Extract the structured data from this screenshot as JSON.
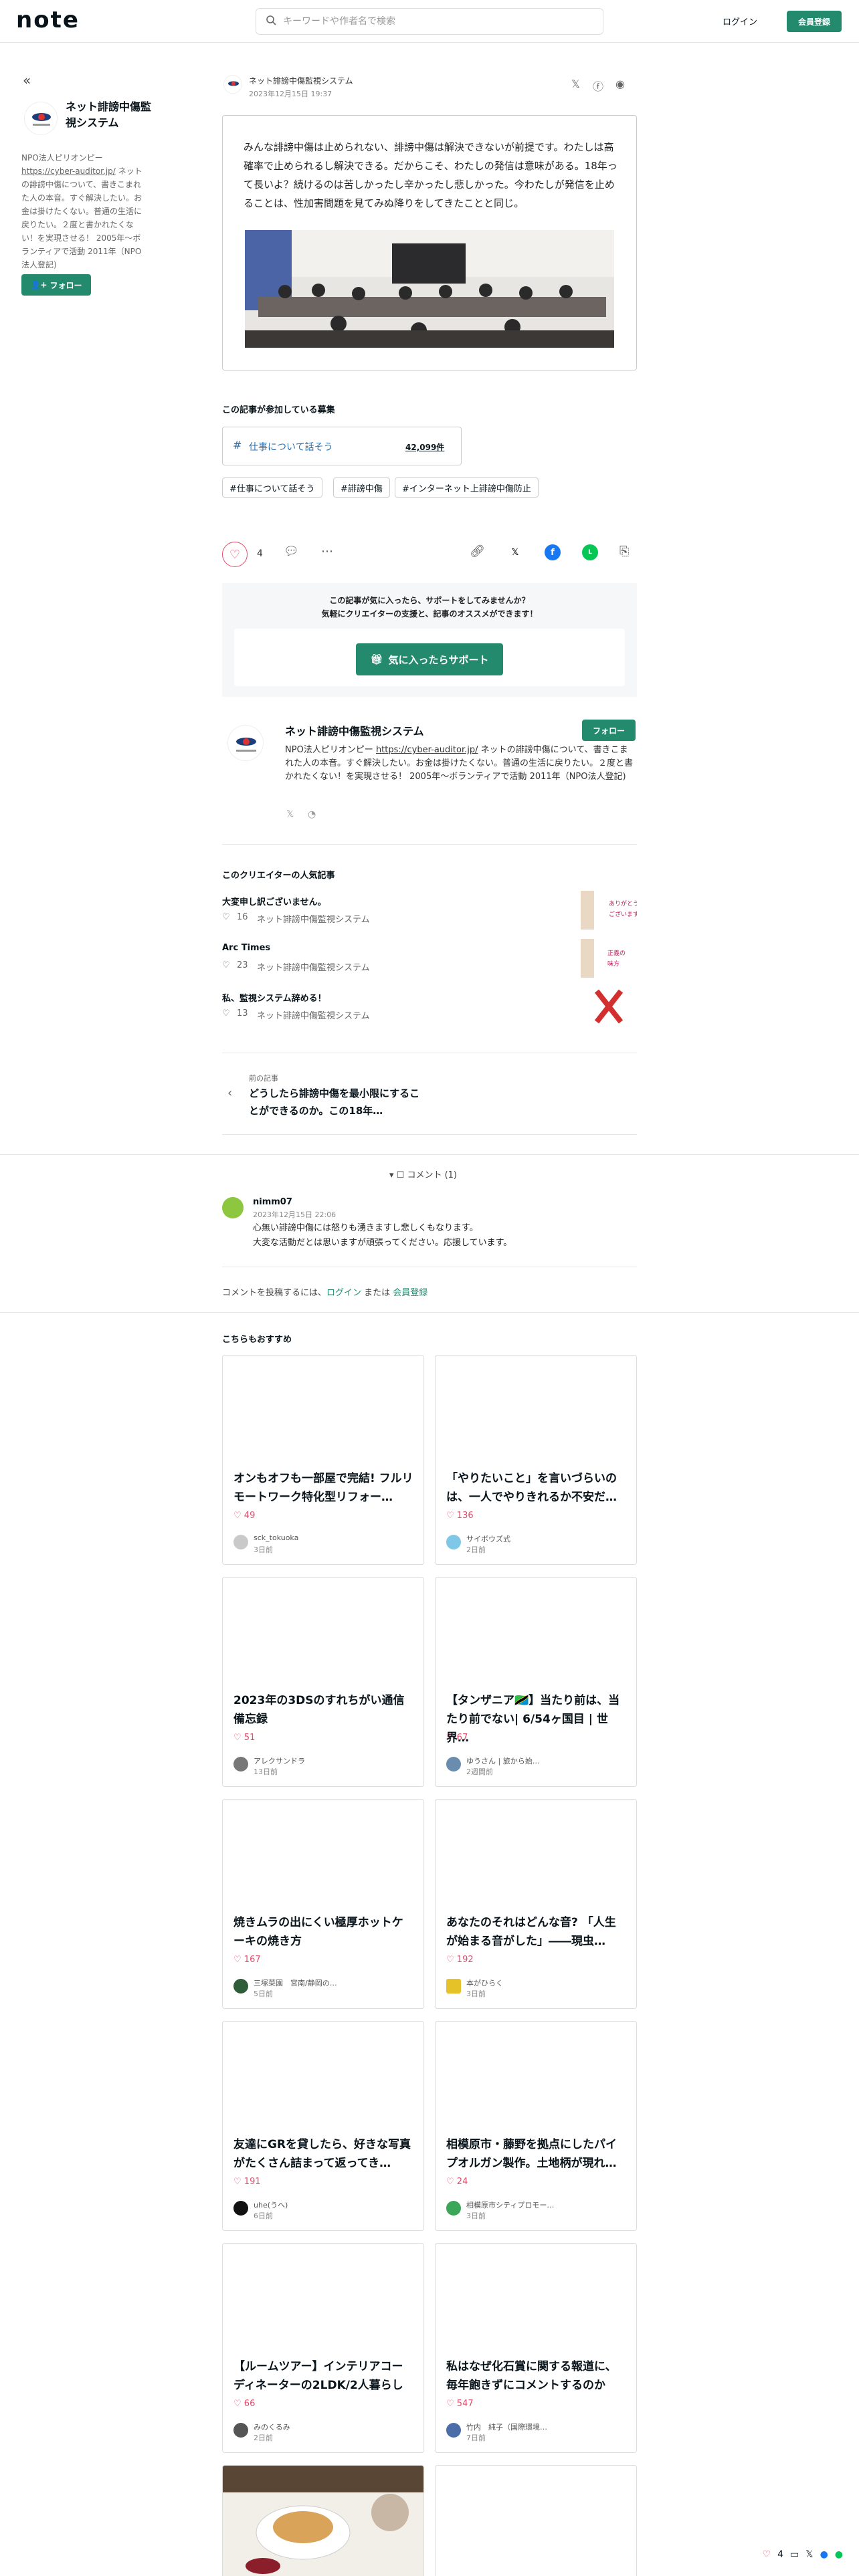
{
  "header": {
    "logo": "note",
    "search_placeholder": "キーワードや作者名で検索",
    "login": "ログイン",
    "signup": "会員登録"
  },
  "sidebar": {
    "creator_name": "ネット誹謗中傷監視システム",
    "bio_prefix": "NPO法人ピリオンピー",
    "bio_link": "https://cyber-auditor.jp/",
    "bio_rest": " ネットの誹謗中傷について、書きこまれた人の本音。すぐ解決したい。お金は掛けたくない。普通の生活に戻りたい。２度と書かれたくない！を実現させる！ 2005年〜ボランティアで活動 2011年（NPO法人登記)",
    "follow": "フォロー"
  },
  "article": {
    "author": "ネット誹謗中傷監視システム",
    "date": "2023年12月15日 19:37",
    "embed_text": "みんな誹謗中傷は止められない、誹謗中傷は解決できないが前提です。わたしは高確率で止められるし解決できる。だからこそ、わたしの発信は意味がある。18年って長いよ？続けるのは苦しかったし辛かったし悲しかった。今わたしが発信を止めることは、性加害問題を見てみぬ降りをしてきたことと同じ。"
  },
  "contest": {
    "title": "この記事が参加している募集",
    "label": "仕事について話そう",
    "count": "42,099件"
  },
  "tags": [
    "#仕事について話そう",
    "#誹謗中傷",
    "#インターネット上誹謗中傷防止"
  ],
  "actions": {
    "likes": "4"
  },
  "support": {
    "line1": "この記事が気に入ったら、サポートをしてみませんか？",
    "line2": "気軽にクリエイターの支援と、記事のオススメができます！",
    "button": "気に入ったらサポート"
  },
  "creator_card": {
    "name": "ネット誹謗中傷監視システム",
    "follow": "フォロー",
    "bio_prefix": "NPO法人ピリオンピー ",
    "bio_link": "https://cyber-auditor.jp/",
    "bio_rest": " ネットの誹謗中傷について、書きこまれた人の本音。すぐ解決したい。お金は掛けたくない。普通の生活に戻りたい。２度と書かれたくない！を実現させる！ 2005年〜ボランティアで活動 2011年（NPO法人登記)"
  },
  "popular": {
    "title": "このクリエイターの人気記事",
    "items": [
      {
        "title": "大変申し訳ございません。",
        "likes": "16",
        "author": "ネット誹謗中傷監視システム"
      },
      {
        "title": "Arc Times",
        "likes": "23",
        "author": "ネット誹謗中傷監視システム"
      },
      {
        "title": "私、監視システム辞める！",
        "likes": "13",
        "author": "ネット誹謗中傷監視システム"
      }
    ]
  },
  "prev": {
    "label": "前の記事",
    "title": "どうしたら誹謗中傷を最小限にすることができるのか。この18年…"
  },
  "comments": {
    "toggle": "コメント (1)",
    "user": "nimm07",
    "date": "2023年12月15日 22:06",
    "line1": "心無い誹謗中傷には怒りも湧きますし悲しくもなります。",
    "line2": "大変な活動だとは思いますが頑張ってください。応援しています。",
    "prompt_prefix": "コメントを投稿するには、",
    "prompt_login": "ログイン",
    "prompt_mid": " または ",
    "prompt_signup": "会員登録"
  },
  "recommend": {
    "title": "こちらもおすすめ",
    "cards": [
      {
        "title": "オンもオフも一部屋で完結! フルリモートワーク特化型リフォー…",
        "likes": "49",
        "author": "sck_tokuoka",
        "time": "3日前"
      },
      {
        "title": "「やりたいこと」を言いづらいのは、一人でやりきれるか不安だ…",
        "likes": "136",
        "author": "サイボウズ式",
        "time": "2日前"
      },
      {
        "title": "2023年の3DSのすれちがい通信備忘録",
        "likes": "51",
        "author": "アレクサンドラ",
        "time": "13日前"
      },
      {
        "title": "【タンザニア🇹🇿】当たり前は、当たり前でない| 6/54ヶ国目 | 世界…",
        "likes": "67",
        "author": "ゆうさん | 旅から始…",
        "time": "2週間前"
      },
      {
        "title": "焼きムラの出にくい極厚ホットケーキの焼き方",
        "likes": "167",
        "author": "三塚菜園　宮南/静岡の…",
        "time": "5日前"
      },
      {
        "title": "あなたのそれはどんな音? 「人生が始まる音がした」――現虫…",
        "likes": "192",
        "author": "本がひらく",
        "time": "3日前"
      },
      {
        "title": "友達にGRを貸したら、好きな写真がたくさん詰まって返ってき…",
        "likes": "191",
        "author": "uhe(うへ)",
        "time": "6日前"
      },
      {
        "title": "相模原市・藤野を拠点にしたパイプオルガン製作。土地柄が現れ…",
        "likes": "24",
        "author": "相模原市シティプロモー…",
        "time": "3日前"
      },
      {
        "title": "【ルームツアー】インテリアコーディネーターの2LDK/2人暮らし",
        "likes": "66",
        "author": "みのくるみ",
        "time": "2日前"
      },
      {
        "title": "私はなぜ化石賞に関する報道に、毎年飽きずにコメントするのか",
        "likes": "547",
        "author": "竹内　純子（国際環境…",
        "time": "7日前"
      }
    ]
  },
  "bottom_bar": {
    "likes": "4"
  },
  "colors": {
    "accent": "#248a6e",
    "like": "#e24b6b",
    "link": "#2a6fb0"
  }
}
